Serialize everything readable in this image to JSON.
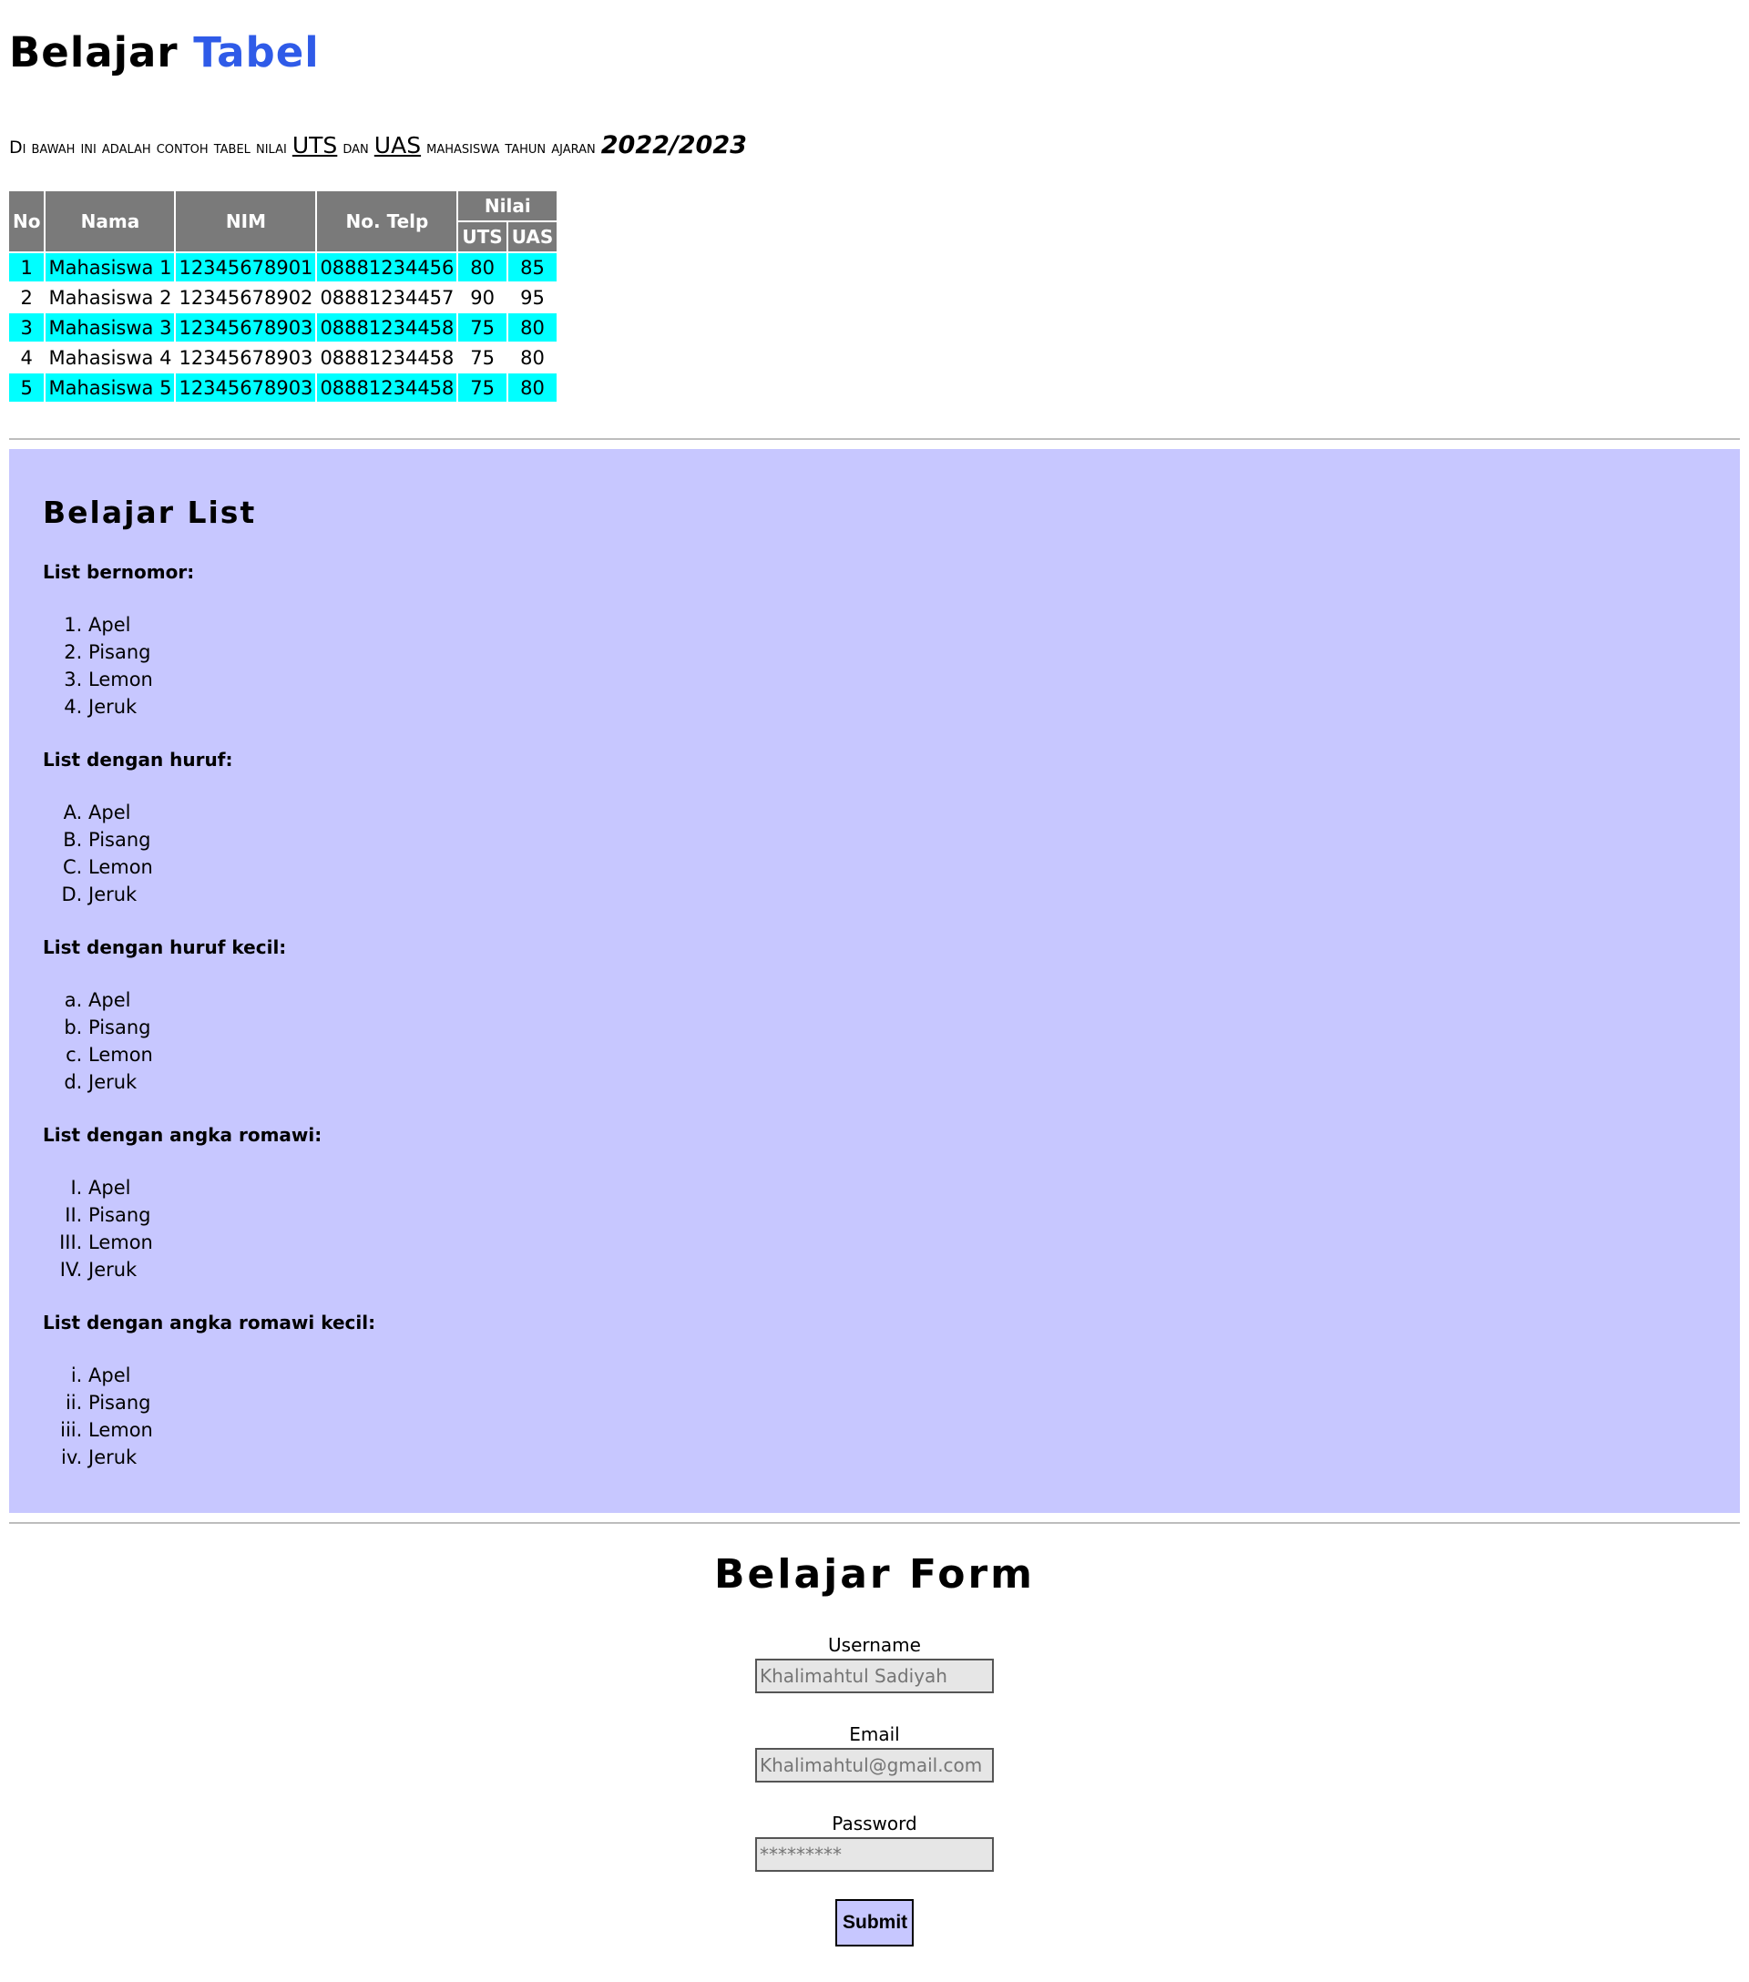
{
  "header": {
    "title_part1": "Belajar",
    "title_part2": "Tabel",
    "intro": {
      "text1": "Di bawah ini adalah contoh tabel nilai",
      "uts": "UTS",
      "text2": "dan",
      "uas": "UAS",
      "text3": "mahasiswa tahun ajaran",
      "year": "2022/2023"
    }
  },
  "table": {
    "headers": {
      "no": "No",
      "nama": "Nama",
      "nim": "NIM",
      "telp": "No. Telp",
      "nilai": "Nilai",
      "uts": "UTS",
      "uas": "UAS"
    },
    "rows": [
      {
        "no": "1",
        "nama": "Mahasiswa 1",
        "nim": "12345678901",
        "telp": "08881234456",
        "uts": "80",
        "uas": "85"
      },
      {
        "no": "2",
        "nama": "Mahasiswa 2",
        "nim": "12345678902",
        "telp": "08881234457",
        "uts": "90",
        "uas": "95"
      },
      {
        "no": "3",
        "nama": "Mahasiswa 3",
        "nim": "12345678903",
        "telp": "08881234458",
        "uts": "75",
        "uas": "80"
      },
      {
        "no": "4",
        "nama": "Mahasiswa 4",
        "nim": "12345678903",
        "telp": "08881234458",
        "uts": "75",
        "uas": "80"
      },
      {
        "no": "5",
        "nama": "Mahasiswa 5",
        "nim": "12345678903",
        "telp": "08881234458",
        "uts": "75",
        "uas": "80"
      }
    ]
  },
  "lists": {
    "title": "Belajar List",
    "groups": [
      {
        "heading": "List bernomor:",
        "type": "1",
        "items": [
          "Apel",
          "Pisang",
          "Lemon",
          "Jeruk"
        ]
      },
      {
        "heading": "List dengan huruf:",
        "type": "A",
        "items": [
          "Apel",
          "Pisang",
          "Lemon",
          "Jeruk"
        ]
      },
      {
        "heading": "List dengan huruf kecil:",
        "type": "a",
        "items": [
          "Apel",
          "Pisang",
          "Lemon",
          "Jeruk"
        ]
      },
      {
        "heading": "List dengan angka romawi:",
        "type": "I",
        "items": [
          "Apel",
          "Pisang",
          "Lemon",
          "Jeruk"
        ]
      },
      {
        "heading": "List dengan angka romawi kecil:",
        "type": "i",
        "items": [
          "Apel",
          "Pisang",
          "Lemon",
          "Jeruk"
        ]
      }
    ]
  },
  "form": {
    "title": "Belajar Form",
    "username_label": "Username",
    "username_placeholder": "Khalimahtul Sadiyah",
    "email_label": "Email",
    "email_placeholder": "Khalimahtul@gmail.com",
    "password_label": "Password",
    "password_placeholder": "*********",
    "submit_label": "Submit"
  },
  "colors": {
    "accent": "#2f5be8",
    "table_header": "#7a7a7a",
    "row_highlight": "#00ffff",
    "list_background": "#c7c7ff"
  }
}
